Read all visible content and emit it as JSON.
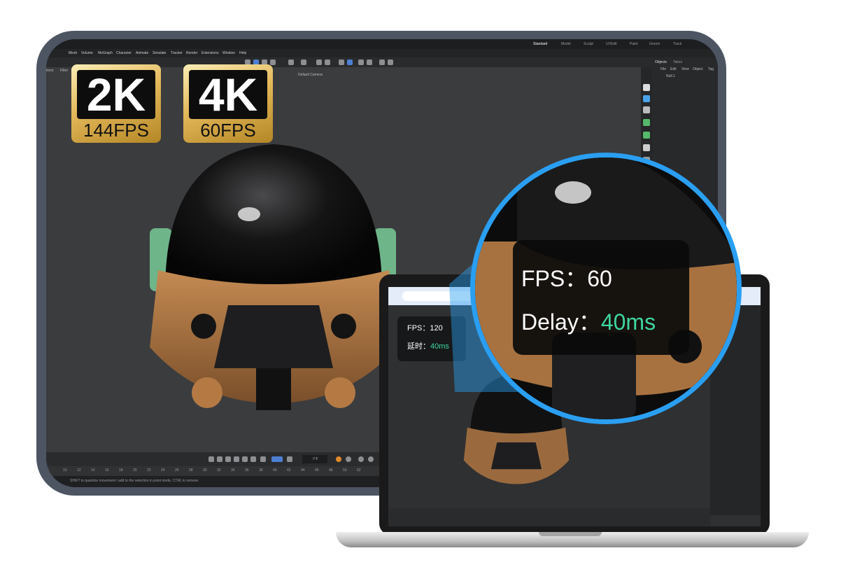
{
  "app": {
    "mode_tabs": [
      "Standard",
      "Model",
      "Sculpt",
      "UVEdit",
      "Paint",
      "Groom",
      "Track"
    ],
    "menu": [
      "Mesh",
      "Volume",
      "MoGraph",
      "Character",
      "Animate",
      "Simulate",
      "Tracker",
      "Render",
      "Extensions",
      "Window",
      "Help"
    ],
    "subbar": [
      "tions",
      "Filter"
    ],
    "viewport_camera": "Default Camera",
    "objects_panel": {
      "tabs": [
        "Objects",
        "Takes"
      ],
      "menu": [
        "File",
        "Edit",
        "View",
        "Object",
        "Tag"
      ],
      "item": "Null.1"
    },
    "timeline_frame": "-7 F",
    "ruler": [
      "10",
      "12",
      "14",
      "16",
      "18",
      "20",
      "22",
      "24",
      "26",
      "28",
      "30",
      "32",
      "34",
      "36",
      "38",
      "40",
      "42",
      "44",
      "46",
      "48",
      "50",
      "52"
    ],
    "status": "SHIFT to quantize movement / add to the selection in point mode, CTRL to remove."
  },
  "badges": [
    {
      "resolution": "2K",
      "fps": "144FPS"
    },
    {
      "resolution": "4K",
      "fps": "60FPS"
    }
  ],
  "laptop_overlay": {
    "fps_label": "FPS：",
    "fps_value": "120",
    "delay_label": "延时：",
    "delay_value": "40ms"
  },
  "magnifier": {
    "fps_label": "FPS：",
    "fps_value": "60",
    "delay_label": "Delay：",
    "delay_value": "40ms"
  },
  "colors": {
    "accent_green": "#3ed6a0",
    "magnifier_ring": "#2a9ff2",
    "badge_gold": "#e3b85a",
    "frame": "#4d5563"
  }
}
